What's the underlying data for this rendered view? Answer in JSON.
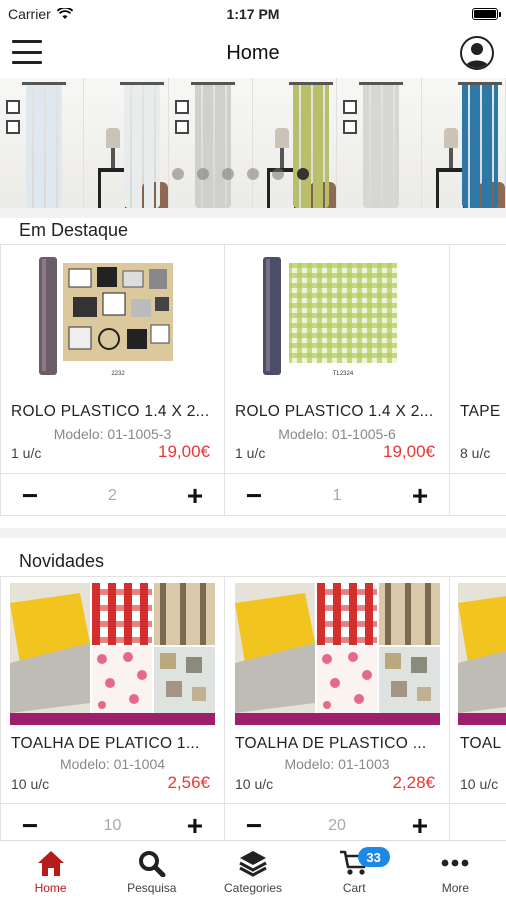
{
  "status": {
    "carrier": "Carrier",
    "time": "1:17 PM"
  },
  "nav": {
    "title": "Home"
  },
  "banner": {
    "slide_count": 6,
    "active_slide": 6,
    "curtain_colors": [
      "#dfe8ee",
      "#e9ecec",
      "#cfd0cc",
      "#b9be6a",
      "#d6d7d3",
      "#2e78a8"
    ]
  },
  "featured": {
    "title": "Em Destaque",
    "products": [
      {
        "name": "ROLO PLASTICO 1.4 X 2...",
        "model": "Modelo: 01-1005-3",
        "units": "1 u/c",
        "price": "19,00€",
        "qty": "2",
        "img_code": "2232"
      },
      {
        "name": "ROLO PLASTICO 1.4 X 2...",
        "model": "Modelo: 01-1005-6",
        "units": "1 u/c",
        "price": "19,00€",
        "qty": "1",
        "img_code": "TL2324"
      },
      {
        "name": "TAPE",
        "model": "",
        "units": "8 u/c",
        "price": "",
        "qty": ""
      }
    ]
  },
  "new": {
    "title": "Novidades",
    "products": [
      {
        "name": "TOALHA DE PLATICO 1...",
        "model": "Modelo: 01-1004",
        "units": "10 u/c",
        "price": "2,56€",
        "qty": "10"
      },
      {
        "name": "TOALHA DE PLASTICO ...",
        "model": "Modelo: 01-1003",
        "units": "10 u/c",
        "price": "2,28€",
        "qty": "20"
      },
      {
        "name": "TOAL",
        "model": "",
        "units": "10 u/c",
        "price": "",
        "qty": ""
      }
    ]
  },
  "tabs": [
    {
      "label": "Home",
      "icon": "home-icon",
      "active": true
    },
    {
      "label": "Pesquisa",
      "icon": "search-icon"
    },
    {
      "label": "Categories",
      "icon": "layers-icon"
    },
    {
      "label": "Cart",
      "icon": "cart-icon",
      "badge": "33"
    },
    {
      "label": "More",
      "icon": "more-icon"
    }
  ],
  "colors": {
    "accent": "#b71c1c",
    "price": "#e53935",
    "badge": "#1e88e5"
  }
}
